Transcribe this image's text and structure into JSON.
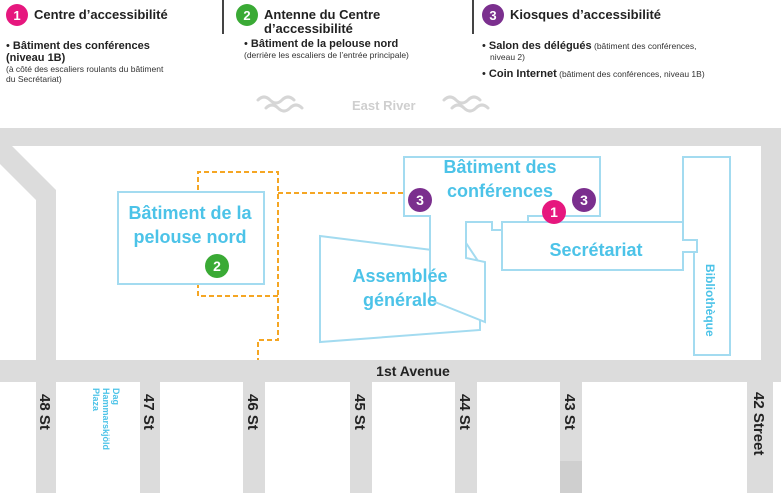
{
  "legend": [
    {
      "number": "1",
      "color": "#e6177e",
      "title": "Centre d’accessibilité",
      "items": [
        {
          "bold": "Bâtiment des conférences",
          "rest": "",
          "line2": "(niveau 1B)",
          "sub": "(à côté des escaliers roulants du bâtiment",
          "sub2": "du Secrétariat)"
        }
      ]
    },
    {
      "number": "2",
      "color": "#3aaa35",
      "title": "Antenne du Centre",
      "title2": "d’accessibilité",
      "items": [
        {
          "bold": "Bâtiment de la pelouse nord",
          "sub": "(derrière les escaliers de l’entrée principale)"
        }
      ]
    },
    {
      "number": "3",
      "color": "#7b2f8e",
      "title": "Kiosques d’accessibilité",
      "items": [
        {
          "bold": "Salon des délégués",
          "rest": " (bâtiment des conférences,",
          "rest2": "niveau 2)"
        },
        {
          "bold": "Coin Internet",
          "rest": " (bâtiment des conférences, niveau 1B)"
        }
      ]
    }
  ],
  "map": {
    "river": "East River",
    "buildings": {
      "conference": [
        "Bâtiment des",
        "conférences"
      ],
      "north_lawn": [
        "Bâtiment de la",
        "pelouse nord"
      ],
      "assembly": [
        "Assemblée",
        "générale"
      ],
      "secretariat": "Secrétariat",
      "library": "Bibliothèque"
    },
    "markers": {
      "m1": "1",
      "m2": "2",
      "m3a": "3",
      "m3b": "3"
    },
    "avenue": "1st Avenue",
    "streets": {
      "s48": "48 St",
      "s47": "47 St",
      "s46": "46 St",
      "s45": "45 St",
      "s44": "44 St",
      "s43": "43 St",
      "s42": "42 Street"
    },
    "plaza": [
      "Dag",
      "Hammarskjöld",
      "Plaza"
    ]
  },
  "colors": {
    "building_stroke": "#a3dbf0",
    "building_fill": "#ffffff",
    "label": "#4cc3e8",
    "road": "#dcdcdc",
    "path": "#f5a623",
    "river": "#d6d6d6"
  }
}
